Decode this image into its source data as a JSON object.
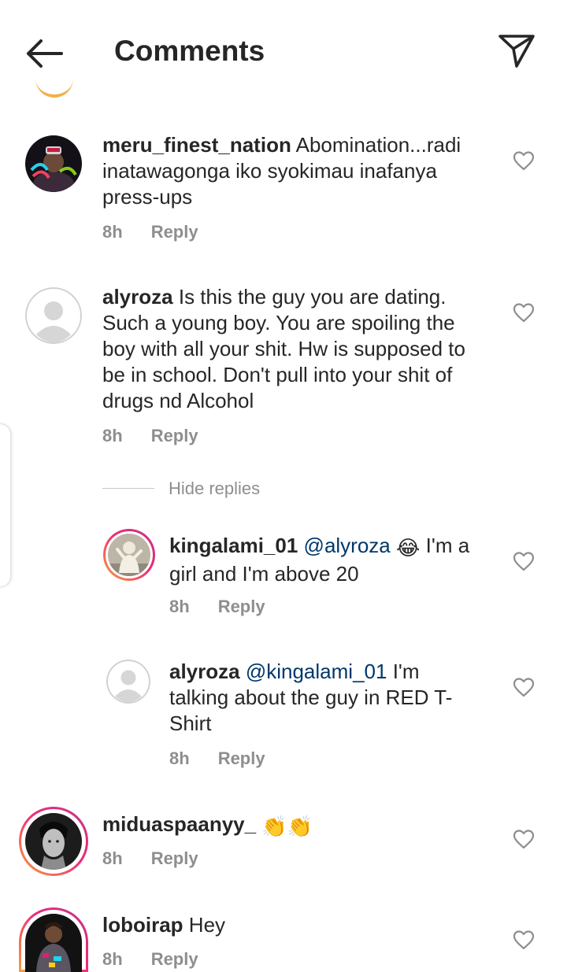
{
  "header": {
    "title": "Comments"
  },
  "icons": {
    "back": "arrow-left-icon",
    "send": "paper-plane-icon",
    "like": "heart-outline-icon"
  },
  "colors": {
    "text": "#262626",
    "meta": "#8e8e8e",
    "mention": "#00376b",
    "story_ring_start": "#f9a13a",
    "story_ring_end": "#c13584"
  },
  "comments": [
    {
      "username": "meru_finest_nation",
      "text": "Abomination...radi inatawagonga iko syokimau inafanya press-ups",
      "time": "8h",
      "reply": "Reply"
    },
    {
      "username": "alyroza",
      "text": "Is this the guy you are dating. Such a young boy. You are spoiling the boy with all your shit. Hw is supposed to be in school. Don't pull into your shit of drugs nd Alcohol",
      "time": "8h",
      "reply": "Reply",
      "hide_replies": "Hide replies",
      "replies": [
        {
          "username": "kingalami_01",
          "mention": "@alyroza",
          "text": "I'm a girl and I'm above 20",
          "emoji": "😂",
          "time": "8h",
          "reply": "Reply"
        },
        {
          "username": "alyroza",
          "mention": "@kingalami_01",
          "text": "I'm talking about the guy in RED T-Shirt",
          "time": "8h",
          "reply": "Reply"
        }
      ]
    },
    {
      "username": "miduaspaanyy_",
      "emoji": "👏👏",
      "time": "8h",
      "reply": "Reply"
    },
    {
      "username": "loboirap",
      "text": "Hey",
      "time": "8h",
      "reply": "Reply"
    }
  ]
}
